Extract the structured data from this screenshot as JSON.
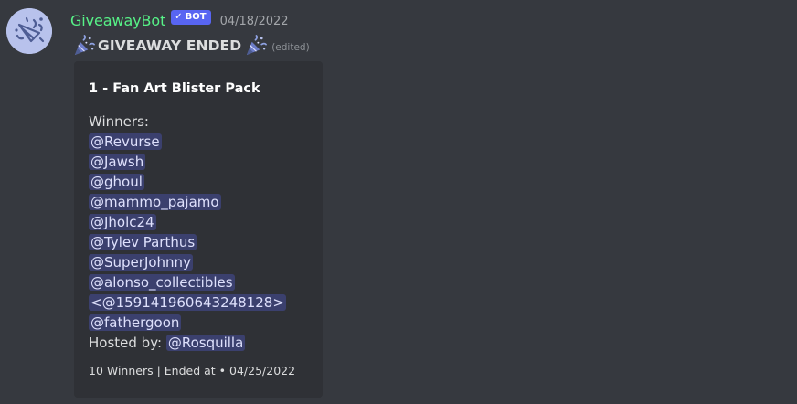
{
  "message": {
    "author": "GiveawayBot",
    "bot_tag": "BOT",
    "timestamp": "04/18/2022",
    "content_text": "GIVEAWAY ENDED",
    "edited": "(edited)",
    "avatar_icon": "party-popper-icon",
    "emoji_icon": "tada-icon"
  },
  "embed": {
    "title": "1 - Fan Art Blister Pack",
    "winners_label": "Winners:",
    "winners": [
      "@Revurse",
      "@Jawsh",
      "@ghoul",
      "@mammo_pajamo",
      "@Jholc24",
      "@Tylev Parthus",
      "@SuperJohnny",
      "@alonso_collectibles",
      "<@159141960643248128>",
      "@fathergoon"
    ],
    "hosted_by_label": "Hosted by:",
    "host": "@Rosquilla",
    "footer": "10 Winners | Ended at • 04/25/2022"
  },
  "colors": {
    "background": "#36393f",
    "embed_background": "#2f3136",
    "username": "#57f287",
    "bot_tag": "#5865f2",
    "mention_bg": "rgba(88,101,242,0.3)",
    "mention_text": "#dee0fc"
  }
}
